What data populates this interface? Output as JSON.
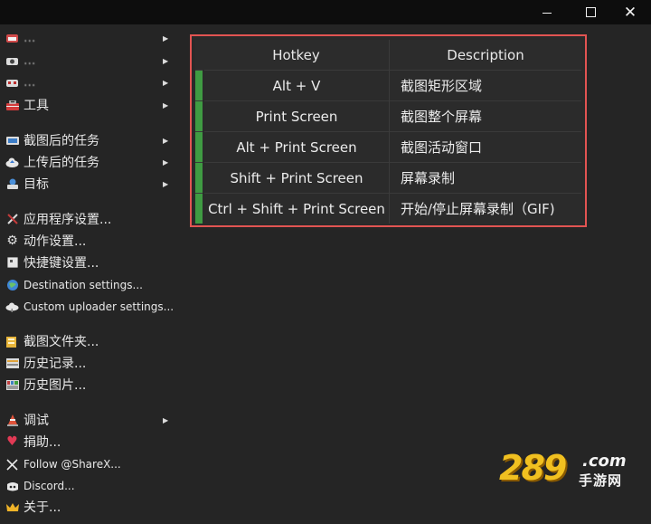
{
  "window_controls": {
    "minimize": "",
    "maximize": "",
    "close": "✕"
  },
  "menu": {
    "items": [
      {
        "label": "...",
        "icon": "capture-icon",
        "has_arrow": true
      },
      {
        "label": "...",
        "icon": "upload-icon",
        "has_arrow": true
      },
      {
        "label": "...",
        "icon": "workflow-icon",
        "has_arrow": true
      },
      {
        "label": "工具",
        "icon": "toolbox-icon",
        "has_arrow": true
      },
      {
        "label": "截图后的任务",
        "icon": "after-capture-icon",
        "has_arrow": true
      },
      {
        "label": "上传后的任务",
        "icon": "cloud-upload-icon",
        "has_arrow": true
      },
      {
        "label": "目标",
        "icon": "destination-icon",
        "has_arrow": true
      },
      {
        "label": "应用程序设置...",
        "icon": "wrench-icon",
        "has_arrow": false
      },
      {
        "label": "动作设置...",
        "icon": "gear-icon",
        "has_arrow": false
      },
      {
        "label": "快捷键设置...",
        "icon": "keyboard-icon",
        "has_arrow": false
      },
      {
        "label": "Destination settings...",
        "icon": "globe-icon",
        "has_arrow": false
      },
      {
        "label": "Custom uploader settings...",
        "icon": "cloud-icon",
        "has_arrow": false
      },
      {
        "label": "截图文件夹...",
        "icon": "folder-icon",
        "has_arrow": false
      },
      {
        "label": "历史记录...",
        "icon": "history-icon",
        "has_arrow": false
      },
      {
        "label": "历史图片...",
        "icon": "image-history-icon",
        "has_arrow": false
      },
      {
        "label": "调试",
        "icon": "traffic-cone-icon",
        "has_arrow": true
      },
      {
        "label": "捐助...",
        "icon": "heart-icon",
        "has_arrow": false
      },
      {
        "label": "Follow @ShareX...",
        "icon": "x-logo-icon",
        "has_arrow": false
      },
      {
        "label": "Discord...",
        "icon": "discord-icon",
        "has_arrow": false
      },
      {
        "label": "关于...",
        "icon": "crown-icon",
        "has_arrow": false
      }
    ]
  },
  "hotkeys_table": {
    "headers": [
      "Hotkey",
      "Description"
    ],
    "rows": [
      {
        "hotkey": "Alt + V",
        "description": "截图矩形区域"
      },
      {
        "hotkey": "Print Screen",
        "description": "截图整个屏幕"
      },
      {
        "hotkey": "Alt + Print Screen",
        "description": "截图活动窗口"
      },
      {
        "hotkey": "Shift + Print Screen",
        "description": "屏幕录制"
      },
      {
        "hotkey": "Ctrl + Shift + Print Screen",
        "description": "开始/停止屏幕录制（GIF)"
      }
    ]
  },
  "watermark": {
    "number": "289",
    "domain": ".com",
    "text": "手游网"
  },
  "colors": {
    "background": "#252525",
    "highlight_border": "#e25452",
    "status_green": "#3f9b42",
    "watermark_gold": "#f0c020"
  }
}
